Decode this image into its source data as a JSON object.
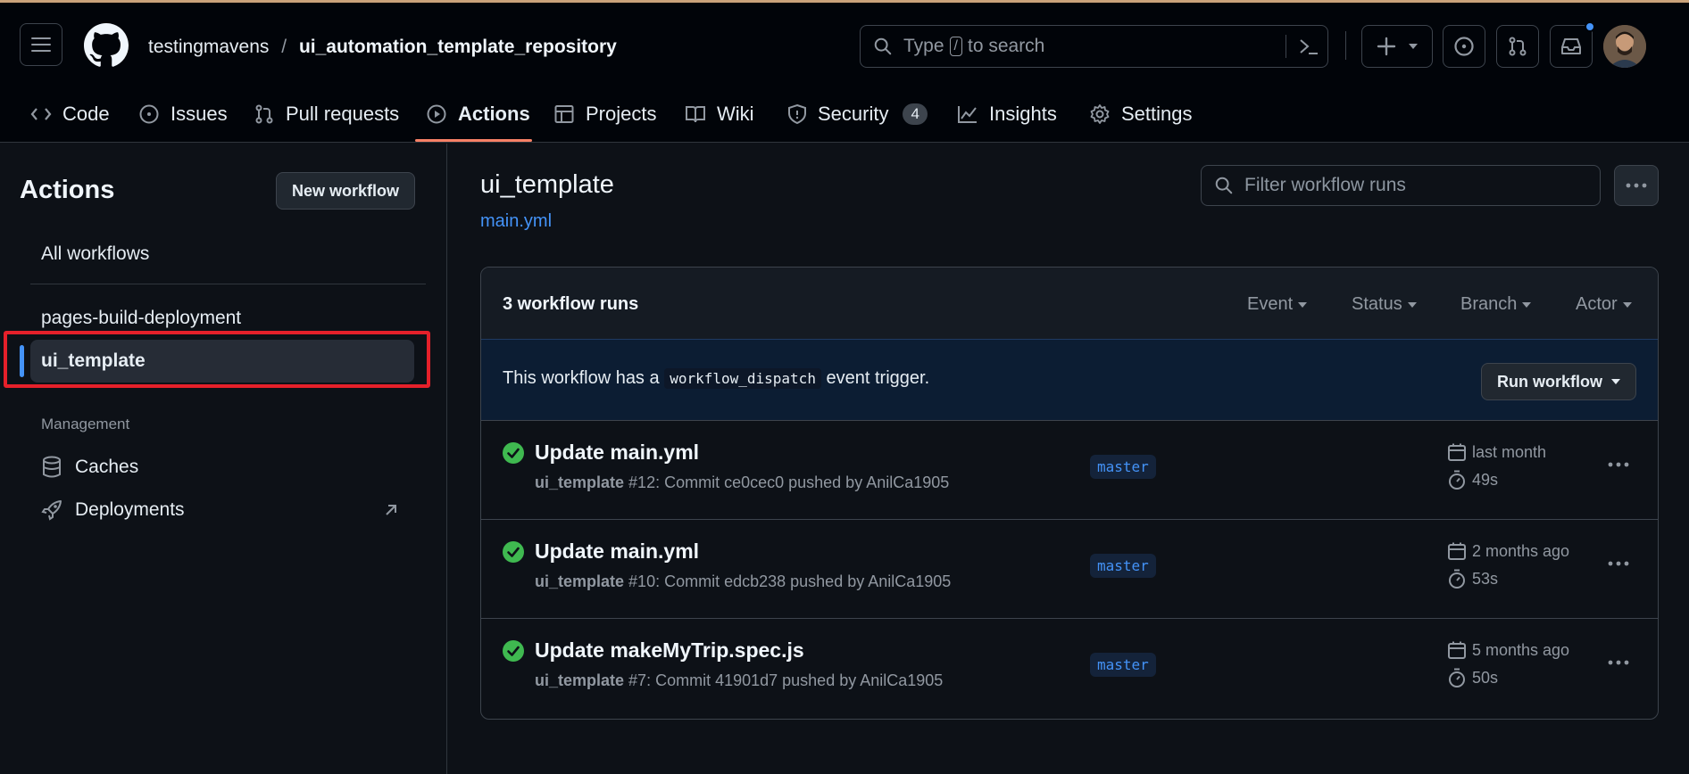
{
  "header": {
    "owner": "testingmavens",
    "separator": "/",
    "repo": "ui_automation_template_repository",
    "search_prefix": "Type",
    "search_key": "/",
    "search_suffix": "to search"
  },
  "tabs": [
    {
      "label": "Code"
    },
    {
      "label": "Issues"
    },
    {
      "label": "Pull requests"
    },
    {
      "label": "Actions"
    },
    {
      "label": "Projects"
    },
    {
      "label": "Wiki"
    },
    {
      "label": "Security",
      "count": "4"
    },
    {
      "label": "Insights"
    },
    {
      "label": "Settings"
    }
  ],
  "sidebar": {
    "title": "Actions",
    "new_workflow": "New workflow",
    "all_workflows": "All workflows",
    "workflows": [
      "pages-build-deployment",
      "ui_template"
    ],
    "management_heading": "Management",
    "management_items": [
      "Caches",
      "Deployments"
    ]
  },
  "main": {
    "title": "ui_template",
    "file_link": "main.yml",
    "filter_placeholder": "Filter workflow runs",
    "runs_count": "3 workflow runs",
    "filters": [
      "Event",
      "Status",
      "Branch",
      "Actor"
    ],
    "dispatch_prefix": "This workflow has a",
    "dispatch_code": "workflow_dispatch",
    "dispatch_suffix": "event trigger.",
    "run_workflow": "Run workflow"
  },
  "runs": [
    {
      "title": "Update main.yml",
      "workflow": "ui_template",
      "detail": "#12: Commit ce0cec0 pushed by AnilCa1905",
      "branch": "master",
      "when": "last month",
      "duration": "49s"
    },
    {
      "title": "Update main.yml",
      "workflow": "ui_template",
      "detail": "#10: Commit edcb238 pushed by AnilCa1905",
      "branch": "master",
      "when": "2 months ago",
      "duration": "53s"
    },
    {
      "title": "Update makeMyTrip.spec.js",
      "workflow": "ui_template",
      "detail": "#7: Commit 41901d7 pushed by AnilCa1905",
      "branch": "master",
      "when": "5 months ago",
      "duration": "50s"
    }
  ],
  "colors": {
    "background": "#0d1117",
    "link": "#4493f8",
    "success": "#3fb950",
    "tab_underline": "#f78166",
    "highlight_box": "#e5202a"
  }
}
